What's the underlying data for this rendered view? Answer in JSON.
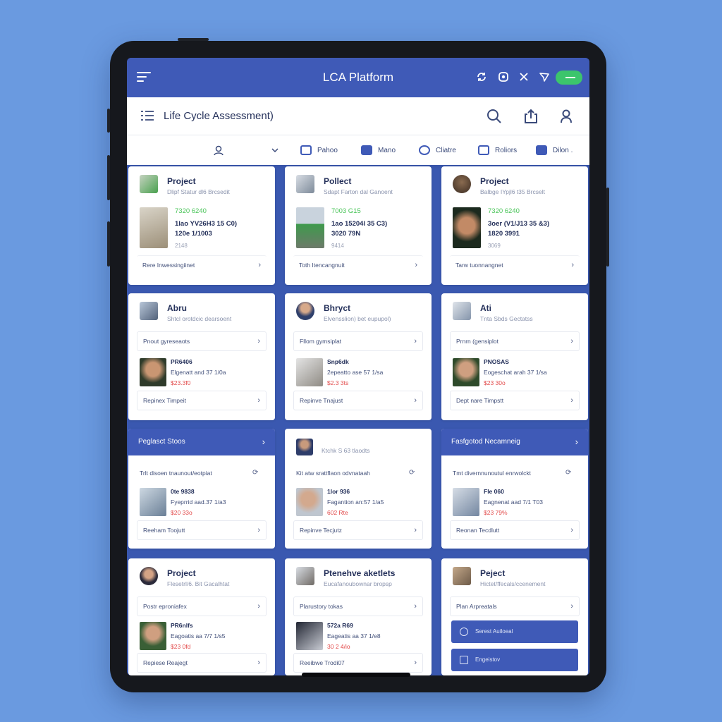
{
  "appbar": {
    "title": "LCA Platform",
    "icons": [
      "menu-icon",
      "sync-icon",
      "settings-icon",
      "close-icon",
      "send-icon",
      "toggle-switch"
    ]
  },
  "header": {
    "title": "Life Cycle Assessment)",
    "icons": [
      "list-icon",
      "search-icon",
      "share-icon",
      "user-icon"
    ]
  },
  "tabs": [
    {
      "label": "",
      "icon": "user-icon"
    },
    {
      "label": "",
      "icon": "chevron-down-icon"
    },
    {
      "label": "Pahoo",
      "icon": "folder-icon"
    },
    {
      "label": "Mano",
      "icon": "map-icon"
    },
    {
      "label": "Cliatre",
      "icon": "climate-icon"
    },
    {
      "label": "Roliors",
      "icon": "report-icon"
    },
    {
      "label": "Dilon .",
      "icon": "data-icon"
    }
  ],
  "cards_row1": [
    {
      "title": "Project",
      "sub": "Dlipf Statur dl6 Brcsedit",
      "l1": "7320 6240",
      "l2": "1lao YV26H3 15 C0)",
      "l3": "120e 1/1003",
      "l4": "2148",
      "link": "Rere Inwessingiinet"
    },
    {
      "title": "Pollect",
      "sub": "Sdapt Farton dal Ganoent",
      "l1": "7003 G15",
      "l2": "1ao 15204l 35 C3)",
      "l3": "3020 79N",
      "l4": "9414",
      "link": "Toth Itencangnuit"
    },
    {
      "title": "Project",
      "sub": "Balbge IYpjl6 t35 Brcselt",
      "l1": "7320 6240",
      "l2": "3oer (V1/J13 35 &3)",
      "l3": "1820 3991",
      "l4": "3069",
      "link": "Tarw tuonnangnet"
    }
  ],
  "cards_row2": [
    {
      "title": "Abru",
      "sub": "Shtcl orotdcic dearsoent",
      "link1": "Pnout gyreseaots",
      "l1": "PR6406",
      "l2": "Elgenatt and 37 1/0a",
      "l3": "$23.3f0",
      "link2": "Repinex Timpeit"
    },
    {
      "title": "Bhryct",
      "sub": "Elvensslion) bet eupupol)",
      "link1": "Fllom gymsiplat",
      "l1": "Snp6dk",
      "l2": "2epeatto ase 57 1/sa",
      "l3": "$2.3 3ts",
      "link2": "Repinve Tnajust"
    },
    {
      "title": "Ati",
      "sub": "Tnta Sbds Gectatss",
      "link1": "Prnrn (gensiplot",
      "l1": "PNOSAS",
      "l2": "Eogeschat arah 37 1/sa",
      "l3": "$23 30o",
      "link2": "Dept nare Timpstt"
    }
  ],
  "cards_row3": [
    {
      "band": "Peglasct Stoos",
      "mini": "Trlt disoen tnaunout/eotpiat",
      "l1": "0te 9838",
      "l2": "Fyeprrid aad.37 1/a3",
      "l3": "$20 33o",
      "link": "Reeham Toojutt"
    },
    {
      "title": "Ktchk S 63 tlaodts",
      "mini": "Kit atw srattflaon odvnataah",
      "l1": "1lor 936",
      "l2": "Fagantion an:57 1/a5",
      "l3": "602 Rte",
      "link": "Repinve Tecjutz"
    },
    {
      "band": "Fasfgotod Necamneig",
      "mini": "Tmt divernnunoutul enrwolckt",
      "l1": "Fle 060",
      "l2": "Eagnenat aad 7/1 T03",
      "l3": "$23 79%",
      "link": "Reonan Tecdlutt"
    }
  ],
  "cards_row4": [
    {
      "title": "Project",
      "sub": "Flesetrl/6. Bit Gacalhtat",
      "link1": "Postr eproniafex",
      "l1": "PR6nlfs",
      "l2": "Eagoatis aa 7/7 1/s5",
      "l3": "$23 0fd",
      "link2": "Repiese Reajegt"
    },
    {
      "title": "Ptenehve aketlets",
      "sub": "Eucafanoubownar bropsp",
      "link1": "Plarustory tokas",
      "l1": "572a R69",
      "l2": "Eageatis aa 37 1/e8",
      "l3": "30 2 4/io",
      "link2": "Reeibwe Trodi07"
    },
    {
      "title": "Peject",
      "sub": "Hictet/ffecals/ccenement",
      "link1": "Plan Arpreatals",
      "btn1": "Serest Auiloeal",
      "btn2": "Engeistov"
    }
  ],
  "colors": {
    "accent": "#3f5ab7",
    "positive": "#49c458",
    "negative": "#e24a4a",
    "background": "#6a9ae0"
  }
}
